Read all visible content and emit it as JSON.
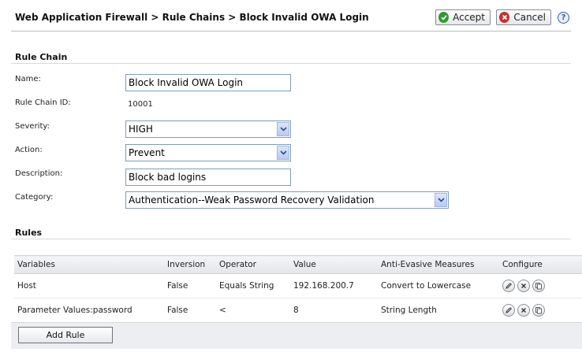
{
  "header": {
    "breadcrumb": "Web Application Firewall > Rule Chains > Block Invalid OWA Login",
    "accept_label": "Accept",
    "cancel_label": "Cancel",
    "help_symbol": "?"
  },
  "rule_chain": {
    "section_title": "Rule Chain",
    "name_label": "Name:",
    "name_value": "Block Invalid OWA Login",
    "id_label": "Rule Chain ID:",
    "id_value": "10001",
    "severity_label": "Severity:",
    "severity_value": "HIGH",
    "action_label": "Action:",
    "action_value": "Prevent",
    "description_label": "Description:",
    "description_value": "Block bad logins",
    "category_label": "Category:",
    "category_value": "Authentication--Weak Password Recovery Validation"
  },
  "rules": {
    "section_title": "Rules",
    "columns": [
      "Variables",
      "Inversion",
      "Operator",
      "Value",
      "Anti-Evasive Measures",
      "Configure"
    ],
    "rows": [
      {
        "variables": "Host",
        "inversion": "False",
        "operator": "Equals String",
        "value": "192.168.200.7",
        "anti_evasive": "Convert to Lowercase"
      },
      {
        "variables": "Parameter Values:password",
        "inversion": "False",
        "operator": "<",
        "value": "8",
        "anti_evasive": "String Length"
      }
    ],
    "add_rule_label": "Add Rule"
  },
  "colors": {
    "accept_icon": "#2f9a2f",
    "cancel_icon": "#c8302c",
    "input_border": "#7f9db9",
    "header_bg": "#e3e5e9"
  }
}
